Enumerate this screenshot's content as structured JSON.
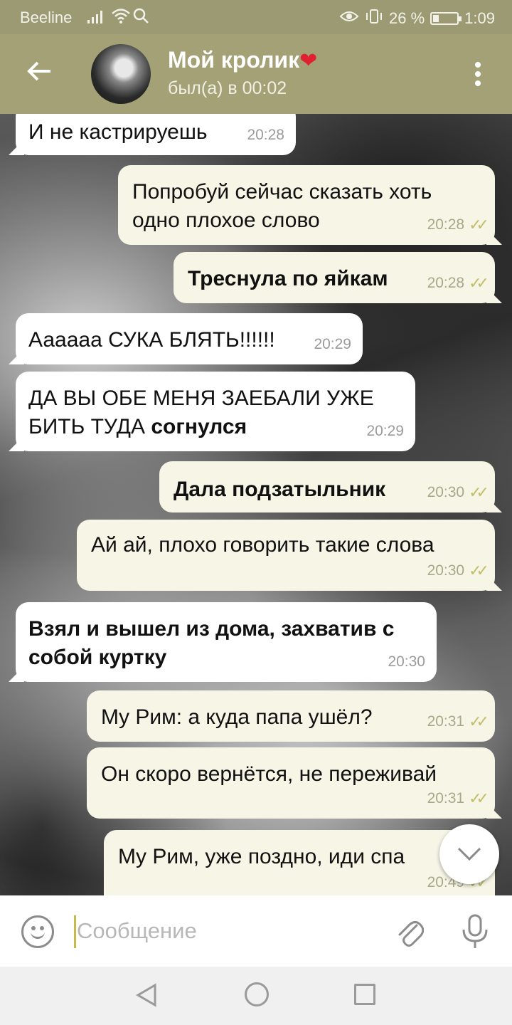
{
  "status_bar": {
    "carrier": "Beeline",
    "battery_percent": "26 %",
    "battery_level": 0.26,
    "time": "1:09"
  },
  "header": {
    "title": "Мой кролик",
    "title_emoji": "❤",
    "subtitle": "был(а) в 00:02"
  },
  "messages": [
    {
      "dir": "in",
      "text": "И не кастрируешь",
      "time": "20:28"
    },
    {
      "dir": "out",
      "text": "Попробуй сейчас сказать хоть одно плохое слово",
      "time": "20:28"
    },
    {
      "dir": "out",
      "text": "Треснула по яйкам",
      "bold": true,
      "time": "20:28"
    },
    {
      "dir": "in",
      "text": "Аааааа СУКА БЛЯТЬ!!!!!!",
      "time": "20:29"
    },
    {
      "dir": "in",
      "text": "ДА ВЫ ОБЕ МЕНЯ ЗАЕБАЛИ УЖЕ БИТЬ ТУДА",
      "text_bold": "согнулся",
      "time": "20:29"
    },
    {
      "dir": "out",
      "text": "Дала подзатыльник",
      "bold": true,
      "time": "20:30"
    },
    {
      "dir": "out",
      "text": "Ай ай, плохо говорить такие слова",
      "time": "20:30"
    },
    {
      "dir": "in",
      "text": "Взял и вышел из дома, захватив с собой куртку",
      "bold": true,
      "time": "20:30"
    },
    {
      "dir": "out",
      "text": "My Рим: а куда папа ушёл?",
      "time": "20:31"
    },
    {
      "dir": "out",
      "text": "Он скоро вернётся, не переживай",
      "time": "20:31"
    },
    {
      "dir": "out",
      "text": "My Рим, уже поздно, иди спа",
      "time": "20:49"
    }
  ],
  "input": {
    "placeholder": "Сообщение"
  },
  "icons": {
    "back": "arrow-left-icon",
    "menu": "more-vertical-icon",
    "emoji": "smiley-icon",
    "attach": "paperclip-icon",
    "mic": "microphone-icon",
    "scroll": "chevron-down-icon"
  },
  "colors": {
    "header": "#a3a175",
    "status_bar": "#9b9a72",
    "out_bubble": "#f7f6e6",
    "in_bubble": "#ffffff",
    "read_check": "#c1bd6b",
    "heart": "#e0212f"
  }
}
